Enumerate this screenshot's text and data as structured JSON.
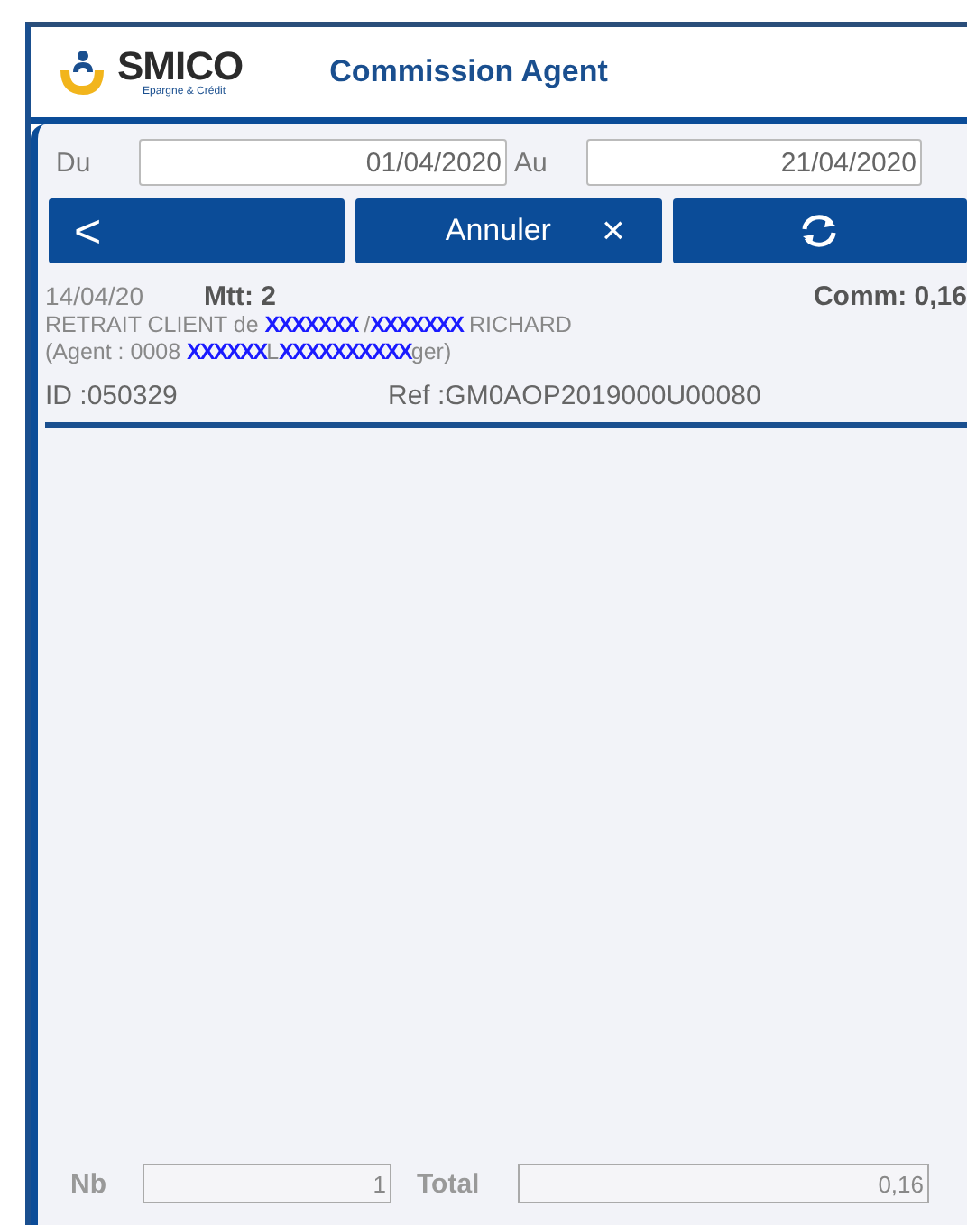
{
  "header": {
    "brand": "SMICO",
    "tagline": "Epargne & Crédit",
    "title": "Commission Agent"
  },
  "filter": {
    "from_label": "Du",
    "from_value": "01/04/2020",
    "to_label": "Au",
    "to_value": "21/04/2020"
  },
  "toolbar": {
    "back_glyph": "<",
    "cancel_label": "Annuler",
    "cancel_glyph": "×"
  },
  "transactions": [
    {
      "date": "14/04/20",
      "amount": "Mtt: 2",
      "commission": "Comm: 0,16",
      "description": [
        [
          {
            "kind": "text",
            "text": "RETRAIT CLIENT de "
          },
          {
            "kind": "redacted",
            "text": "XXXXXXX"
          },
          {
            "kind": "text",
            "text": " /"
          },
          {
            "kind": "redacted",
            "text": "XXXXXXX"
          },
          {
            "kind": "text",
            "text": " RICHARD"
          }
        ],
        [
          {
            "kind": "text",
            "text": "(Agent : 0008 "
          },
          {
            "kind": "redacted",
            "text": "XXXXXX"
          },
          {
            "kind": "text",
            "text": "L"
          },
          {
            "kind": "redacted",
            "text": "XXXXXXXXXX"
          },
          {
            "kind": "text",
            "text": "ger)"
          }
        ]
      ],
      "id": "ID :050329",
      "ref": "Ref :GM0AOP2019000U00080"
    }
  ],
  "footer": {
    "count_label": "Nb",
    "count_value": "1",
    "total_label": "Total",
    "total_value": "0,16"
  }
}
